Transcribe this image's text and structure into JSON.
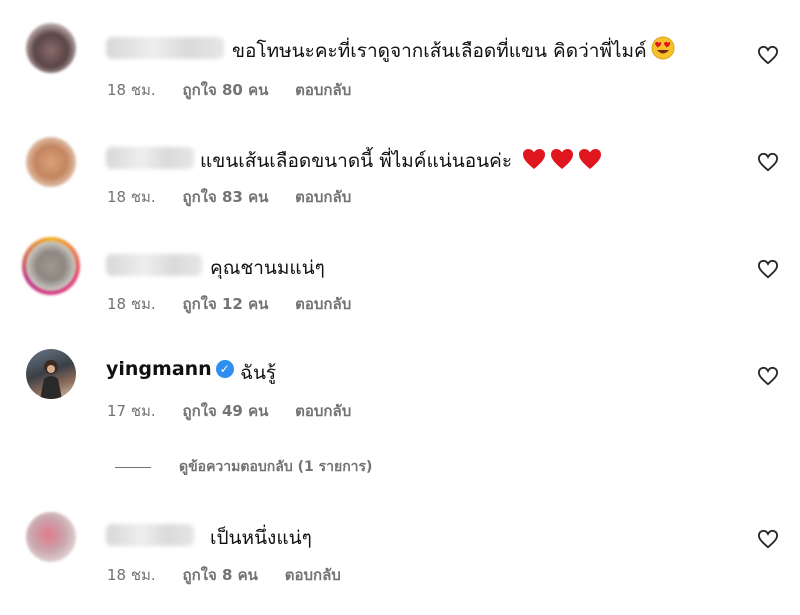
{
  "comments": [
    {
      "username": "",
      "text": "ขอโทษนะคะที่เราดูจากเส้นเลือดที่แขน คิดว่าพี่ไมค์",
      "emoji": "heart-eyes-emoji",
      "time": "18 ชม.",
      "likes": "ถูกใจ 80 คน",
      "reply": "ตอบกลับ"
    },
    {
      "username": "",
      "text": "แขนเส้นเลือดขนาดนี้ พี่ไมค์แน่นอนค่ะ",
      "emoji": "red-heart-emoji",
      "time": "18 ชม.",
      "likes": "ถูกใจ 83 คน",
      "reply": "ตอบกลับ"
    },
    {
      "username": "",
      "text": "คุณชานมแน่ๆ",
      "time": "18 ชม.",
      "likes": "ถูกใจ 12 คน",
      "reply": "ตอบกลับ"
    },
    {
      "username": "yingmann",
      "verified": true,
      "text": "ฉันรู้",
      "time": "17 ชม.",
      "likes": "ถูกใจ 49 คน",
      "reply": "ตอบกลับ"
    },
    {
      "username": "",
      "text": "เป็นหนึ่งแน่ๆ",
      "time": "18 ชม.",
      "likes": "ถูกใจ 8 คน",
      "reply": "ตอบกลับ"
    }
  ],
  "view_replies": "ดูข้อความตอบกลับ (1 รายการ)",
  "colors": {
    "meta": "#737373",
    "verified": "#2f8ff0",
    "emoji_red": "#e0161e"
  }
}
